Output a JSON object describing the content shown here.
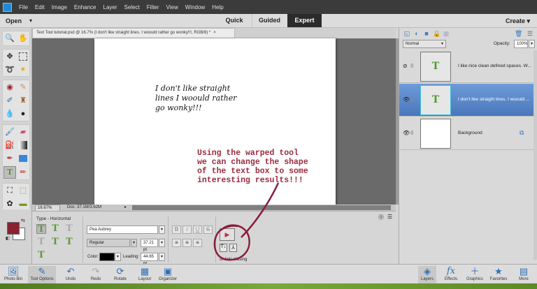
{
  "menubar": {
    "items": [
      "File",
      "Edit",
      "Image",
      "Enhance",
      "Layer",
      "Select",
      "Filter",
      "View",
      "Window",
      "Help"
    ]
  },
  "modebar": {
    "open": "Open",
    "modes": [
      "Quick",
      "Guided",
      "Expert"
    ],
    "active_mode": "Expert",
    "create": "Create"
  },
  "document": {
    "tab_title": "Text Tool tutorial.psd @ 16.7% (I don't like straight lines. I woould rather go wonky!!!, RGB/8) *",
    "handwritten_text": [
      "I don't like straight",
      "lines I woould rather",
      "go wonky!!!"
    ],
    "note_text": "Using the warped tool\nwe can change the shape\nof the text box to some\ninteresting results!!!"
  },
  "status": {
    "zoom": "16.67%",
    "doc": "Doc: 37.1M/3.62M"
  },
  "colors": {
    "foreground": "#8b2232",
    "background": "#ffffff",
    "accent": "#4a77bb",
    "annotation": "#8b1c3a"
  },
  "tool_options": {
    "title": "Type - Horizontal",
    "font": "Pea Aubrey",
    "style": "Regular",
    "size": "37.21 pt",
    "color_label": "Color:",
    "leading_label": "Leading:",
    "leading": "44.65 pt",
    "anti_aliasing": "Anti-aliasing",
    "bold": "B",
    "italic": "I",
    "underline": "U",
    "strike": "S"
  },
  "layers_panel": {
    "blend_mode": "Normal",
    "opacity_label": "Opacity:",
    "opacity": "100%",
    "layers": [
      {
        "name": "I like nice clean defined spaces. W...",
        "type": "text",
        "visible": false,
        "selected": false
      },
      {
        "name": "I don't like straight lines. I woould ...",
        "type": "text",
        "visible": true,
        "selected": true
      },
      {
        "name": "Background",
        "type": "image",
        "visible": true,
        "selected": false
      }
    ]
  },
  "bottombar": {
    "left": [
      "Photo Bin",
      "Tool Options",
      "Undo",
      "Redo",
      "Rotate",
      "Layout",
      "Organizer"
    ],
    "right": [
      "Layers",
      "Effects",
      "Graphics",
      "Favorites",
      "More"
    ]
  }
}
